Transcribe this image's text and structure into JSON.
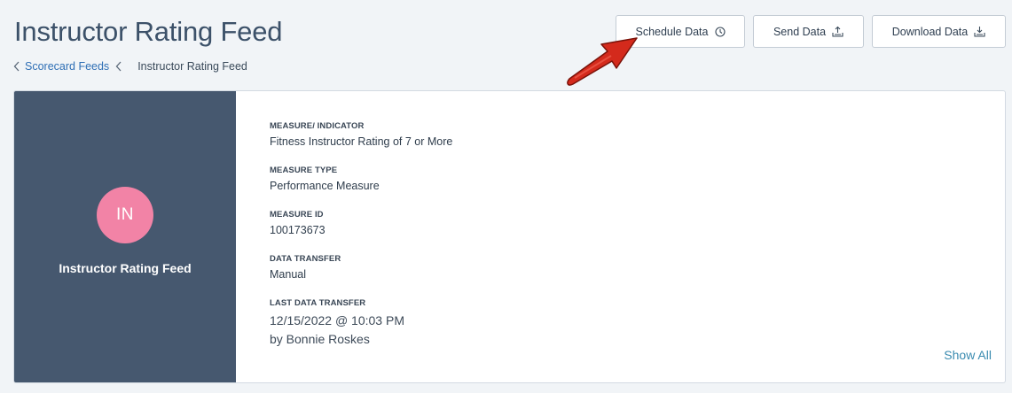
{
  "header": {
    "title": "Instructor Rating Feed"
  },
  "breadcrumb": {
    "parent": "Scorecard Feeds",
    "current": "Instructor Rating Feed"
  },
  "actions": {
    "schedule": "Schedule Data",
    "send": "Send Data",
    "download": "Download Data"
  },
  "card": {
    "initials": "IN",
    "name": "Instructor Rating Feed",
    "avatar_color": "#f283a6",
    "panel_color": "#46586f",
    "fields": [
      {
        "label": "MEASURE/ INDICATOR",
        "value": "Fitness Instructor Rating of 7 or More"
      },
      {
        "label": "MEASURE TYPE",
        "value": "Performance Measure"
      },
      {
        "label": "MEASURE ID",
        "value": "100173673"
      },
      {
        "label": "DATA TRANSFER",
        "value": "Manual"
      },
      {
        "label": "LAST DATA TRANSFER",
        "value": "12/15/2022 @ 10:03 PM",
        "value2": "by Bonnie Roskes"
      }
    ],
    "show_all": "Show All"
  },
  "icons": {
    "schedule": "clock-icon",
    "send": "upload-tray-icon",
    "download": "download-tray-icon",
    "back": "chevron-left-icon"
  },
  "annotation": {
    "arrow_color": "#d42a1c"
  }
}
